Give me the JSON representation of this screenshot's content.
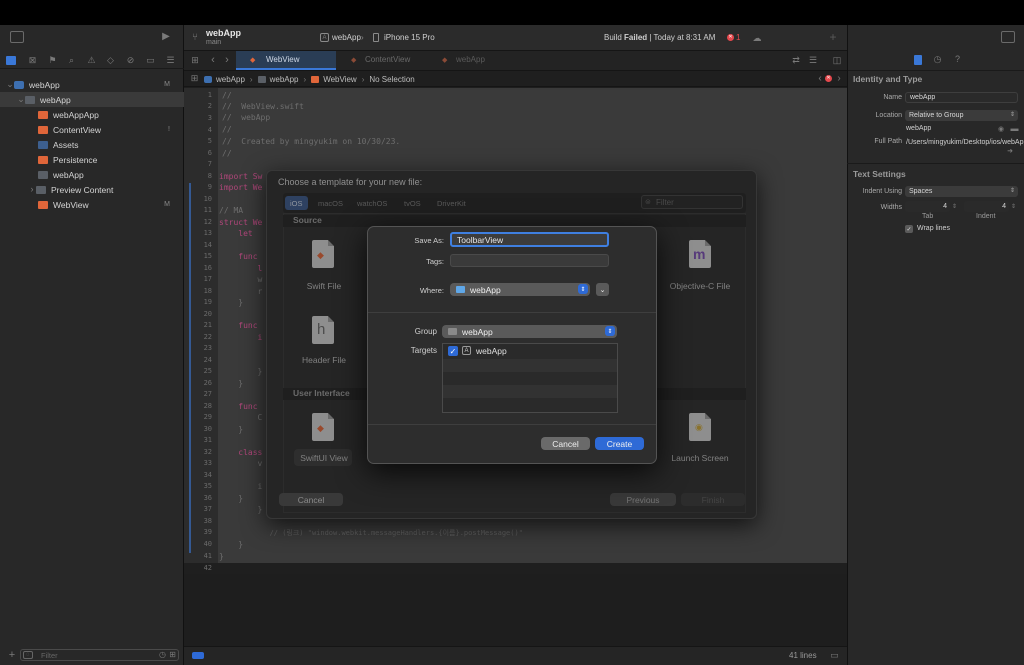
{
  "colors": {
    "accent": "#2e6ad6",
    "error": "#e5484d",
    "swift": "#e0663a",
    "folder": "#5fa7e8"
  },
  "toolbar": {
    "project": "webApp",
    "branch": "main",
    "scheme": "webApp",
    "destination": "iPhone 15 Pro",
    "build_prefix": "Build",
    "build_status": "Failed",
    "build_time": "| Today at 8:31 AM",
    "error_count": "1"
  },
  "tabs": [
    "WebView",
    "ContentView",
    "webApp"
  ],
  "jumpbar": [
    "webApp",
    "webApp",
    "WebView",
    "No Selection"
  ],
  "navigator": {
    "filter_placeholder": "Filter",
    "items": [
      {
        "label": "webApp",
        "badge": "M"
      },
      {
        "label": "webApp",
        "badge": ""
      },
      {
        "label": "webAppApp",
        "badge": ""
      },
      {
        "label": "ContentView",
        "badge": "!"
      },
      {
        "label": "Assets",
        "badge": ""
      },
      {
        "label": "Persistence",
        "badge": ""
      },
      {
        "label": "webApp",
        "badge": ""
      },
      {
        "label": "Preview Content",
        "badge": ""
      },
      {
        "label": "WebView",
        "badge": "M"
      }
    ]
  },
  "editor": {
    "line_numbers": [
      "1",
      "2",
      "3",
      "4",
      "5",
      "6",
      "7",
      "8",
      "9",
      "10",
      "11",
      "12",
      "13",
      "14",
      "15",
      "16",
      "17",
      "18",
      "19",
      "20",
      "21",
      "22",
      "23",
      "24",
      "25",
      "26",
      "27",
      "28",
      "29",
      "30",
      "31",
      "32",
      "33",
      "34",
      "35",
      "36",
      "37",
      "38",
      "39",
      "40",
      "41",
      "42"
    ],
    "code": {
      "l1": "//",
      "l2": "//  WebView.swift",
      "l3": "//  webApp",
      "l4": "//",
      "l5": "//  Created by mingyukim on 10/30/23.",
      "l6": "//",
      "l8": "import Sw",
      "l9": "import We",
      "l11": "// MA",
      "l12": "struct We",
      "l13": "    let",
      "l15": "    func",
      "l16": "        l",
      "l17": "        w",
      "l18": "        r",
      "l19": "    }",
      "l21": "    func",
      "l22": "        i",
      "l25": "        }",
      "l26": "    }",
      "l28": "    func",
      "l29": "        C",
      "l30": "    }",
      "l32": "    class",
      "l33": "        v",
      "l35": "        i",
      "l36": "    }",
      "l37": "        }",
      "l39": "            // (링크) \"window.webkit.messageHandlers.{이름}.postMessage()\"",
      "l40": "    }",
      "l41": "}"
    }
  },
  "template_sheet": {
    "title": "Choose a template for your new file:",
    "platforms": [
      "iOS",
      "macOS",
      "watchOS",
      "tvOS",
      "DriverKit"
    ],
    "filter_placeholder": "Filter",
    "sections": [
      "Source",
      "User Interface"
    ],
    "tiles": [
      "Swift File",
      "Objective-C File",
      "Header File",
      "SwiftUI View",
      "Launch Screen"
    ],
    "cancel": "Cancel",
    "previous": "Previous",
    "finish": "Finish"
  },
  "save_dialog": {
    "save_as_label": "Save As:",
    "save_as_value": "ToolbarView",
    "tags_label": "Tags:",
    "tags_value": "",
    "where_label": "Where:",
    "where_value": "webApp",
    "group_label": "Group",
    "group_value": "webApp",
    "targets_label": "Targets",
    "target": "webApp",
    "cancel": "Cancel",
    "create": "Create"
  },
  "inspector": {
    "identity_header": "Identity and Type",
    "name_label": "Name",
    "name_value": "webApp",
    "location_label": "Location",
    "location_value": "Relative to Group",
    "location_file": "webApp",
    "full_path_label": "Full Path",
    "full_path_value": "/Users/mingyukim/Desktop/ios/webApp/webApp",
    "text_settings_header": "Text Settings",
    "indent_using_label": "Indent Using",
    "indent_using_value": "Spaces",
    "widths_label": "Widths",
    "tab_width": "4",
    "indent_width": "4",
    "tab_label": "Tab",
    "indent_label": "Indent",
    "wrap_label": "Wrap lines"
  },
  "status": {
    "lines": "41 lines"
  }
}
